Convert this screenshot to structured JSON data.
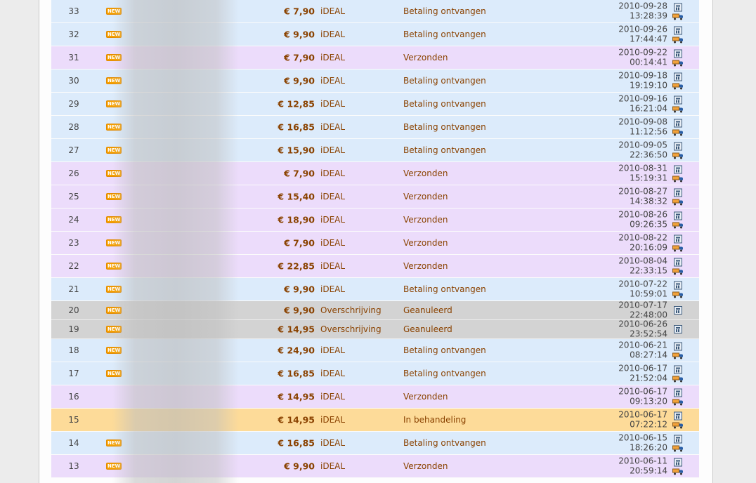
{
  "orders": [
    {
      "id": "33",
      "new": true,
      "amount": "€ 7,90",
      "method": "iDEAL",
      "status": "Betaling ontvangen",
      "date": "2010-09-28",
      "time": "13:28:39",
      "kind": "ideal-paid",
      "truck": true
    },
    {
      "id": "32",
      "new": true,
      "amount": "€ 9,90",
      "method": "iDEAL",
      "status": "Betaling ontvangen",
      "date": "2010-09-26",
      "time": "17:44:47",
      "kind": "ideal-paid",
      "truck": true
    },
    {
      "id": "31",
      "new": true,
      "amount": "€ 7,90",
      "method": "iDEAL",
      "status": "Verzonden",
      "date": "2010-09-22",
      "time": "00:14:41",
      "kind": "shipped",
      "truck": true
    },
    {
      "id": "30",
      "new": true,
      "amount": "€ 9,90",
      "method": "iDEAL",
      "status": "Betaling ontvangen",
      "date": "2010-09-18",
      "time": "19:19:10",
      "kind": "ideal-paid",
      "truck": true
    },
    {
      "id": "29",
      "new": true,
      "amount": "€ 12,85",
      "method": "iDEAL",
      "status": "Betaling ontvangen",
      "date": "2010-09-16",
      "time": "16:21:04",
      "kind": "ideal-paid",
      "truck": true
    },
    {
      "id": "28",
      "new": true,
      "amount": "€ 16,85",
      "method": "iDEAL",
      "status": "Betaling ontvangen",
      "date": "2010-09-08",
      "time": "11:12:56",
      "kind": "ideal-paid",
      "truck": true
    },
    {
      "id": "27",
      "new": true,
      "amount": "€ 15,90",
      "method": "iDEAL",
      "status": "Betaling ontvangen",
      "date": "2010-09-05",
      "time": "22:36:50",
      "kind": "ideal-paid",
      "truck": true
    },
    {
      "id": "26",
      "new": true,
      "amount": "€ 7,90",
      "method": "iDEAL",
      "status": "Verzonden",
      "date": "2010-08-31",
      "time": "15:19:31",
      "kind": "shipped",
      "truck": true
    },
    {
      "id": "25",
      "new": true,
      "amount": "€ 15,40",
      "method": "iDEAL",
      "status": "Verzonden",
      "date": "2010-08-27",
      "time": "14:38:32",
      "kind": "shipped",
      "truck": true
    },
    {
      "id": "24",
      "new": true,
      "amount": "€ 18,90",
      "method": "iDEAL",
      "status": "Verzonden",
      "date": "2010-08-26",
      "time": "09:26:35",
      "kind": "shipped",
      "truck": true
    },
    {
      "id": "23",
      "new": true,
      "amount": "€ 7,90",
      "method": "iDEAL",
      "status": "Verzonden",
      "date": "2010-08-22",
      "time": "20:16:09",
      "kind": "shipped",
      "truck": true
    },
    {
      "id": "22",
      "new": true,
      "amount": "€ 22,85",
      "method": "iDEAL",
      "status": "Verzonden",
      "date": "2010-08-04",
      "time": "22:33:15",
      "kind": "shipped",
      "truck": true
    },
    {
      "id": "21",
      "new": true,
      "amount": "€ 9,90",
      "method": "iDEAL",
      "status": "Betaling ontvangen",
      "date": "2010-07-22",
      "time": "10:59:01",
      "kind": "ideal-paid",
      "truck": true
    },
    {
      "id": "20",
      "new": true,
      "amount": "€ 9,90",
      "method": "Overschrijving",
      "status": "Geanuleerd",
      "date": "2010-07-17",
      "time": "22:48:00",
      "kind": "cancelled",
      "truck": false
    },
    {
      "id": "19",
      "new": true,
      "amount": "€ 14,95",
      "method": "Overschrijving",
      "status": "Geanuleerd",
      "date": "2010-06-26",
      "time": "23:52:54",
      "kind": "cancelled",
      "truck": false
    },
    {
      "id": "18",
      "new": true,
      "amount": "€ 24,90",
      "method": "iDEAL",
      "status": "Betaling ontvangen",
      "date": "2010-06-21",
      "time": "08:27:14",
      "kind": "ideal-paid",
      "truck": true
    },
    {
      "id": "17",
      "new": true,
      "amount": "€ 16,85",
      "method": "iDEAL",
      "status": "Betaling ontvangen",
      "date": "2010-06-17",
      "time": "21:52:04",
      "kind": "ideal-paid",
      "truck": true
    },
    {
      "id": "16",
      "new": false,
      "amount": "€ 14,95",
      "method": "iDEAL",
      "status": "Verzonden",
      "date": "2010-06-17",
      "time": "09:13:20",
      "kind": "shipped",
      "truck": true
    },
    {
      "id": "15",
      "new": false,
      "amount": "€ 14,95",
      "method": "iDEAL",
      "status": "In behandeling",
      "date": "2010-06-17",
      "time": "07:22:12",
      "kind": "processing",
      "truck": true
    },
    {
      "id": "14",
      "new": true,
      "amount": "€ 16,85",
      "method": "iDEAL",
      "status": "Betaling ontvangen",
      "date": "2010-06-15",
      "time": "18:26:20",
      "kind": "ideal-paid",
      "truck": true
    },
    {
      "id": "13",
      "new": true,
      "amount": "€ 9,90",
      "method": "iDEAL",
      "status": "Verzonden",
      "date": "2010-06-11",
      "time": "20:59:14",
      "kind": "shipped",
      "truck": true
    }
  ],
  "badge": {
    "new_label": "NEW"
  },
  "colors": {
    "amount_text": "#8a4200",
    "ideal_row": "#dcebfb",
    "shipped_row": "#ecdcfb",
    "cancelled_row": "#d3d3d3",
    "processing_row": "#fddb99"
  },
  "icons": {
    "invoice": "calculator-icon",
    "shipping": "truck-icon"
  }
}
